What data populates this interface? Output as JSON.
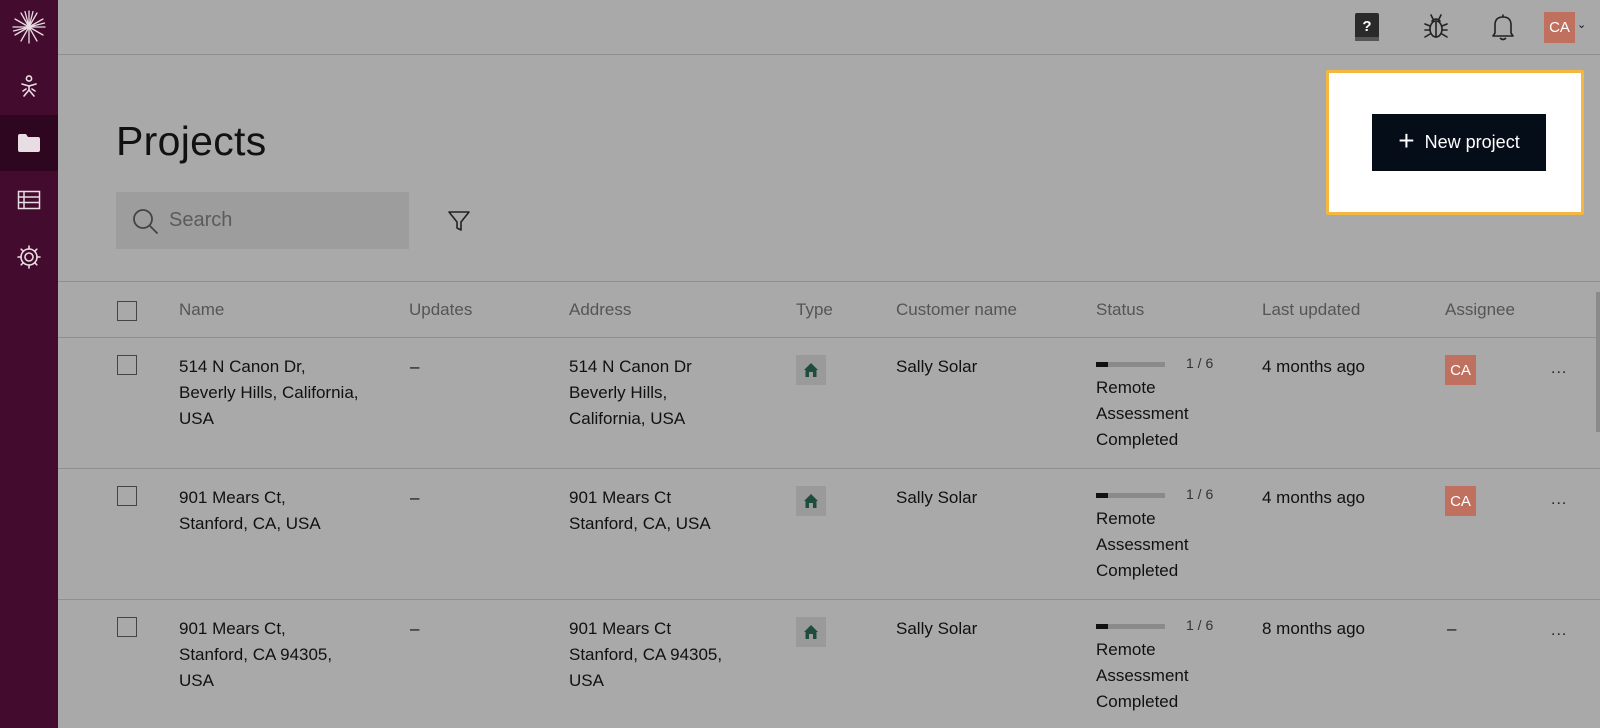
{
  "sidebar": {
    "logo_icon": "starburst-logo-icon",
    "items": [
      {
        "icon": "person-icon",
        "active": false
      },
      {
        "icon": "folder-icon",
        "active": true
      },
      {
        "icon": "table-icon",
        "active": false
      },
      {
        "icon": "gear-icon",
        "active": false
      }
    ],
    "bg_color": "#430b2e"
  },
  "topbar": {
    "icons": [
      "help-book-icon",
      "bug-icon",
      "bell-icon"
    ],
    "avatar_initials": "CA",
    "avatar_color": "#c0705e"
  },
  "page": {
    "title": "Projects",
    "new_project_label": "New project",
    "search_placeholder": "Search"
  },
  "table": {
    "columns": [
      "Name",
      "Updates",
      "Address",
      "Type",
      "Customer name",
      "Status",
      "Last updated",
      "Assignee"
    ],
    "rows": [
      {
        "name": [
          "514 N Canon Dr,",
          "Beverly Hills, California,",
          "USA"
        ],
        "updates": "–",
        "address": [
          "514 N Canon Dr",
          "Beverly Hills,",
          "California, USA"
        ],
        "type_icon": "house-icon",
        "customer": "Sally Solar",
        "progress": "1 / 6",
        "progress_fraction": 0.1667,
        "status": [
          "Remote",
          "Assessment",
          "Completed"
        ],
        "last_updated": "4 months ago",
        "assignee": "CA",
        "more": "..."
      },
      {
        "name": [
          "901 Mears Ct,",
          "Stanford, CA, USA"
        ],
        "updates": "–",
        "address": [
          "901 Mears Ct",
          "Stanford, CA, USA"
        ],
        "type_icon": "house-icon",
        "customer": "Sally Solar",
        "progress": "1 / 6",
        "progress_fraction": 0.1667,
        "status": [
          "Remote",
          "Assessment",
          "Completed"
        ],
        "last_updated": "4 months ago",
        "assignee": "CA",
        "more": "..."
      },
      {
        "name": [
          "901 Mears Ct,",
          "Stanford, CA 94305,",
          "USA"
        ],
        "updates": "–",
        "address": [
          "901 Mears Ct",
          "Stanford, CA 94305,",
          "USA"
        ],
        "type_icon": "house-icon",
        "customer": "Sally Solar",
        "progress": "1 / 6",
        "progress_fraction": 0.1667,
        "status": [
          "Remote",
          "Assessment",
          "Completed"
        ],
        "last_updated": "8 months ago",
        "assignee": "–",
        "more": "..."
      }
    ]
  },
  "colors": {
    "overlay_bg": "#a9a9a9",
    "button_bg": "#050d18",
    "highlight_border": "#f4b740",
    "house_green": "#1f4d3c"
  }
}
